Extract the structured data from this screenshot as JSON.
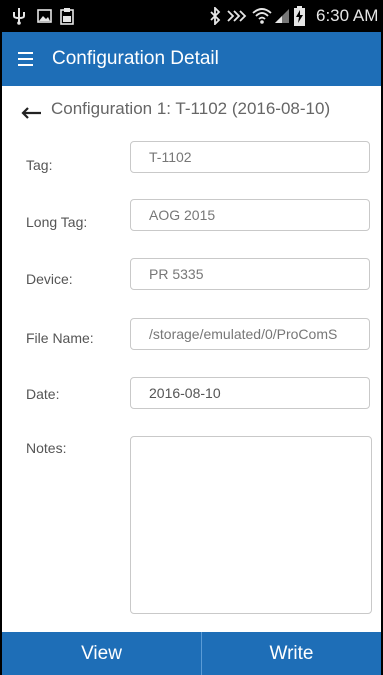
{
  "status_bar": {
    "time": "6:30 AM",
    "left_icons": [
      "usb-icon",
      "image-icon",
      "clipboard-icon"
    ],
    "right_icons": [
      "bluetooth-icon",
      "nfc-icon",
      "wifi-icon",
      "signal-icon",
      "battery-charging-icon"
    ]
  },
  "app_bar": {
    "title": "Configuration Detail",
    "menu_icon": "hamburger-menu-icon",
    "background": "#1e6eb7"
  },
  "header": {
    "back_icon": "back-arrow-icon",
    "text": "Configuration 1: T-1102  (2016-08-10)"
  },
  "form": {
    "tag_label": "Tag:",
    "tag_value": "T-1102",
    "long_tag_label": "Long Tag:",
    "long_tag_value": "AOG 2015",
    "device_label": "Device:",
    "device_value": "PR 5335",
    "file_name_label": "File Name:",
    "file_name_value": "/storage/emulated/0/ProComS",
    "date_label": "Date:",
    "date_value": "2016-08-10",
    "notes_label": "Notes:",
    "notes_value": ""
  },
  "bottom_bar": {
    "view_label": "View",
    "write_label": "Write"
  }
}
